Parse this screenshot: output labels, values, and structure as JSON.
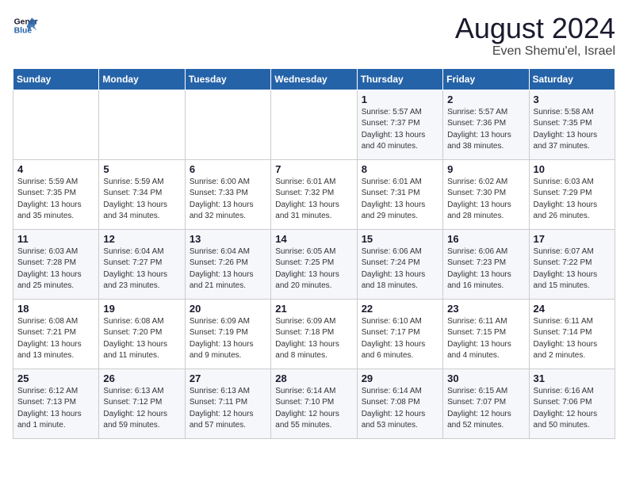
{
  "logo": {
    "line1": "General",
    "line2": "Blue"
  },
  "title": {
    "month_year": "August 2024",
    "location": "Even Shemu'el, Israel"
  },
  "headers": [
    "Sunday",
    "Monday",
    "Tuesday",
    "Wednesday",
    "Thursday",
    "Friday",
    "Saturday"
  ],
  "weeks": [
    [
      {
        "day": "",
        "info": ""
      },
      {
        "day": "",
        "info": ""
      },
      {
        "day": "",
        "info": ""
      },
      {
        "day": "",
        "info": ""
      },
      {
        "day": "1",
        "info": "Sunrise: 5:57 AM\nSunset: 7:37 PM\nDaylight: 13 hours\nand 40 minutes."
      },
      {
        "day": "2",
        "info": "Sunrise: 5:57 AM\nSunset: 7:36 PM\nDaylight: 13 hours\nand 38 minutes."
      },
      {
        "day": "3",
        "info": "Sunrise: 5:58 AM\nSunset: 7:35 PM\nDaylight: 13 hours\nand 37 minutes."
      }
    ],
    [
      {
        "day": "4",
        "info": "Sunrise: 5:59 AM\nSunset: 7:35 PM\nDaylight: 13 hours\nand 35 minutes."
      },
      {
        "day": "5",
        "info": "Sunrise: 5:59 AM\nSunset: 7:34 PM\nDaylight: 13 hours\nand 34 minutes."
      },
      {
        "day": "6",
        "info": "Sunrise: 6:00 AM\nSunset: 7:33 PM\nDaylight: 13 hours\nand 32 minutes."
      },
      {
        "day": "7",
        "info": "Sunrise: 6:01 AM\nSunset: 7:32 PM\nDaylight: 13 hours\nand 31 minutes."
      },
      {
        "day": "8",
        "info": "Sunrise: 6:01 AM\nSunset: 7:31 PM\nDaylight: 13 hours\nand 29 minutes."
      },
      {
        "day": "9",
        "info": "Sunrise: 6:02 AM\nSunset: 7:30 PM\nDaylight: 13 hours\nand 28 minutes."
      },
      {
        "day": "10",
        "info": "Sunrise: 6:03 AM\nSunset: 7:29 PM\nDaylight: 13 hours\nand 26 minutes."
      }
    ],
    [
      {
        "day": "11",
        "info": "Sunrise: 6:03 AM\nSunset: 7:28 PM\nDaylight: 13 hours\nand 25 minutes."
      },
      {
        "day": "12",
        "info": "Sunrise: 6:04 AM\nSunset: 7:27 PM\nDaylight: 13 hours\nand 23 minutes."
      },
      {
        "day": "13",
        "info": "Sunrise: 6:04 AM\nSunset: 7:26 PM\nDaylight: 13 hours\nand 21 minutes."
      },
      {
        "day": "14",
        "info": "Sunrise: 6:05 AM\nSunset: 7:25 PM\nDaylight: 13 hours\nand 20 minutes."
      },
      {
        "day": "15",
        "info": "Sunrise: 6:06 AM\nSunset: 7:24 PM\nDaylight: 13 hours\nand 18 minutes."
      },
      {
        "day": "16",
        "info": "Sunrise: 6:06 AM\nSunset: 7:23 PM\nDaylight: 13 hours\nand 16 minutes."
      },
      {
        "day": "17",
        "info": "Sunrise: 6:07 AM\nSunset: 7:22 PM\nDaylight: 13 hours\nand 15 minutes."
      }
    ],
    [
      {
        "day": "18",
        "info": "Sunrise: 6:08 AM\nSunset: 7:21 PM\nDaylight: 13 hours\nand 13 minutes."
      },
      {
        "day": "19",
        "info": "Sunrise: 6:08 AM\nSunset: 7:20 PM\nDaylight: 13 hours\nand 11 minutes."
      },
      {
        "day": "20",
        "info": "Sunrise: 6:09 AM\nSunset: 7:19 PM\nDaylight: 13 hours\nand 9 minutes."
      },
      {
        "day": "21",
        "info": "Sunrise: 6:09 AM\nSunset: 7:18 PM\nDaylight: 13 hours\nand 8 minutes."
      },
      {
        "day": "22",
        "info": "Sunrise: 6:10 AM\nSunset: 7:17 PM\nDaylight: 13 hours\nand 6 minutes."
      },
      {
        "day": "23",
        "info": "Sunrise: 6:11 AM\nSunset: 7:15 PM\nDaylight: 13 hours\nand 4 minutes."
      },
      {
        "day": "24",
        "info": "Sunrise: 6:11 AM\nSunset: 7:14 PM\nDaylight: 13 hours\nand 2 minutes."
      }
    ],
    [
      {
        "day": "25",
        "info": "Sunrise: 6:12 AM\nSunset: 7:13 PM\nDaylight: 13 hours\nand 1 minute."
      },
      {
        "day": "26",
        "info": "Sunrise: 6:13 AM\nSunset: 7:12 PM\nDaylight: 12 hours\nand 59 minutes."
      },
      {
        "day": "27",
        "info": "Sunrise: 6:13 AM\nSunset: 7:11 PM\nDaylight: 12 hours\nand 57 minutes."
      },
      {
        "day": "28",
        "info": "Sunrise: 6:14 AM\nSunset: 7:10 PM\nDaylight: 12 hours\nand 55 minutes."
      },
      {
        "day": "29",
        "info": "Sunrise: 6:14 AM\nSunset: 7:08 PM\nDaylight: 12 hours\nand 53 minutes."
      },
      {
        "day": "30",
        "info": "Sunrise: 6:15 AM\nSunset: 7:07 PM\nDaylight: 12 hours\nand 52 minutes."
      },
      {
        "day": "31",
        "info": "Sunrise: 6:16 AM\nSunset: 7:06 PM\nDaylight: 12 hours\nand 50 minutes."
      }
    ]
  ]
}
